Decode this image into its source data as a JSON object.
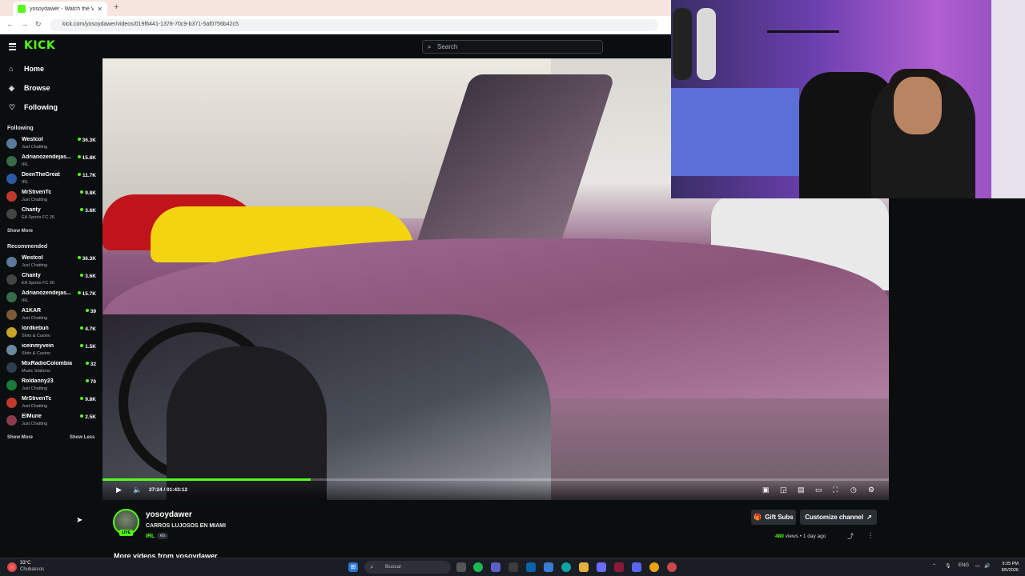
{
  "browser": {
    "tab_title": "yosoydawer - Watch the V",
    "tab_close": "✕",
    "new_tab": "+",
    "url": "kick.com/yosoydawer/videos/019f6441-1378-70c9-b371-5af0756b42c5"
  },
  "kick": {
    "logo": "KICK",
    "search_placeholder": "Search",
    "nav": [
      {
        "label": "Home",
        "icon": "home-icon"
      },
      {
        "label": "Browse",
        "icon": "compass-icon"
      },
      {
        "label": "Following",
        "icon": "heart-icon"
      }
    ],
    "following_title": "Following",
    "following": [
      {
        "name": "Westcol",
        "category": "Just Chatting",
        "viewers": "36.3K",
        "color": "#5a7a9a"
      },
      {
        "name": "Adrianozendejas...",
        "category": "IRL",
        "viewers": "15.8K",
        "color": "#3a6a4a"
      },
      {
        "name": "DeenTheGreat",
        "category": "IRL",
        "viewers": "11.7K",
        "color": "#2a5aa0"
      },
      {
        "name": "MrStivenTc",
        "category": "Just Chatting",
        "viewers": "9.8K",
        "color": "#c0392b"
      },
      {
        "name": "Chanty",
        "category": "EA Sports FC 26",
        "viewers": "3.6K",
        "color": "#444"
      }
    ],
    "show_more_1": "Show More",
    "recommended_title": "Recommended",
    "recommended": [
      {
        "name": "Westcol",
        "category": "Just Chatting",
        "viewers": "36.3K",
        "color": "#5a7a9a"
      },
      {
        "name": "Chanty",
        "category": "EA Sports FC 26",
        "viewers": "3.6K",
        "color": "#444"
      },
      {
        "name": "Adrianozendejas...",
        "category": "IRL",
        "viewers": "15.7K",
        "color": "#3a6a4a"
      },
      {
        "name": "A1KAR",
        "category": "Just Chatting",
        "viewers": "39",
        "color": "#7a5a3a"
      },
      {
        "name": "lordkebun",
        "category": "Slots & Casino",
        "viewers": "4.7K",
        "color": "#c9a227"
      },
      {
        "name": "iceinmyvein",
        "category": "Slots & Casino",
        "viewers": "1.5K",
        "color": "#6a8aa0"
      },
      {
        "name": "MixRadioColombia",
        "category": "Music Stations",
        "viewers": "32",
        "color": "#2c3e50"
      },
      {
        "name": "Roldanny23",
        "category": "Just Chatting",
        "viewers": "70",
        "color": "#1a7a3a"
      },
      {
        "name": "MrStivenTc",
        "category": "Just Chatting",
        "viewers": "9.8K",
        "color": "#c0392b"
      },
      {
        "name": "ElMune",
        "category": "Just Chatting",
        "viewers": "2.5K",
        "color": "#8a3a4a"
      }
    ],
    "show_more_2": "Show More",
    "show_less": "Show Less"
  },
  "player": {
    "time": "27:24 / 01:43:12",
    "progress": 0.265
  },
  "channel": {
    "name": "yosoydawer",
    "title": "CARROS LUJOSOS EN MIAMI",
    "category": "IRL",
    "language": "es",
    "live_badge": "LIVE",
    "gift_subs": "Gift Subs",
    "customize": "Customize channel",
    "views_count": "480",
    "views_label": "views",
    "age": "1 day ago",
    "more_videos": "More videos from yosoydawer"
  },
  "taskbar": {
    "temp": "33°C",
    "condition": "Chubascos",
    "search": "Buscar",
    "lang": "ENG",
    "time": "9:25 PM",
    "date": "8/5/2026"
  }
}
